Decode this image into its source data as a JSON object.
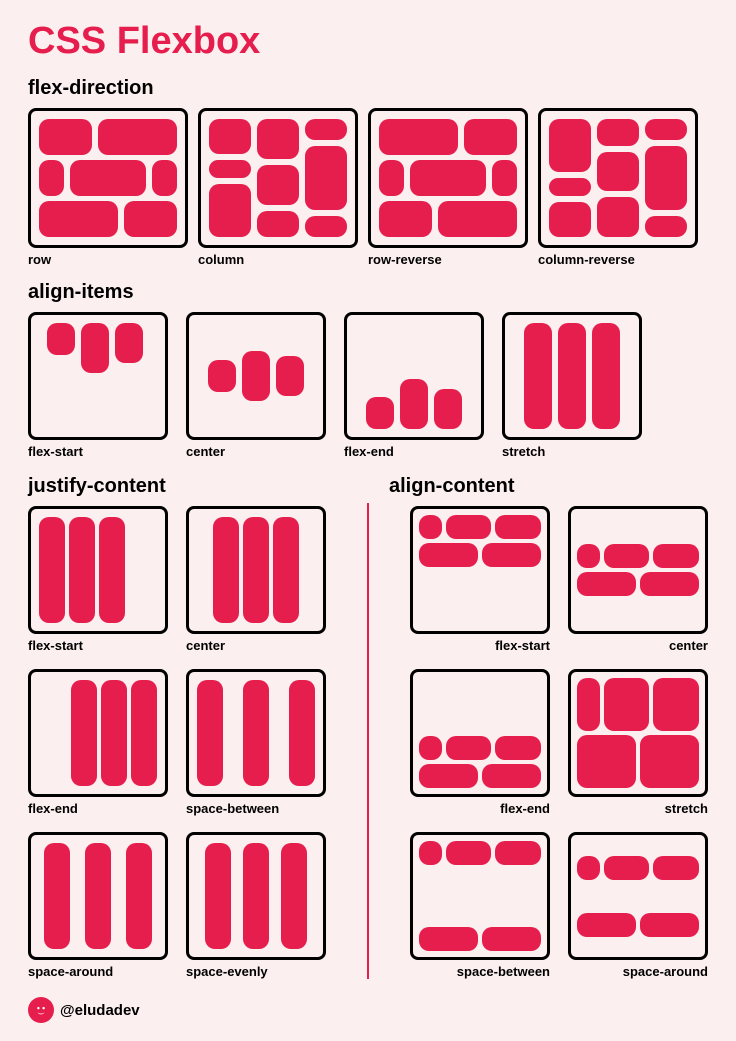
{
  "title": "CSS Flexbox",
  "colors": {
    "accent": "#e61e4d",
    "bg": "#fcefef",
    "border": "#000000"
  },
  "sections": {
    "flex_direction": {
      "heading": "flex-direction",
      "items": [
        "row",
        "column",
        "row-reverse",
        "column-reverse"
      ]
    },
    "align_items": {
      "heading": "align-items",
      "items": [
        "flex-start",
        "center",
        "flex-end",
        "stretch"
      ]
    },
    "justify_content": {
      "heading": "justify-content",
      "items": [
        "flex-start",
        "center",
        "flex-end",
        "space-between",
        "space-around",
        "space-evenly"
      ]
    },
    "align_content": {
      "heading": "align-content",
      "items": [
        "flex-start",
        "center",
        "flex-end",
        "stretch",
        "space-between",
        "space-around"
      ]
    }
  },
  "footer": {
    "handle": "@eludadev"
  }
}
